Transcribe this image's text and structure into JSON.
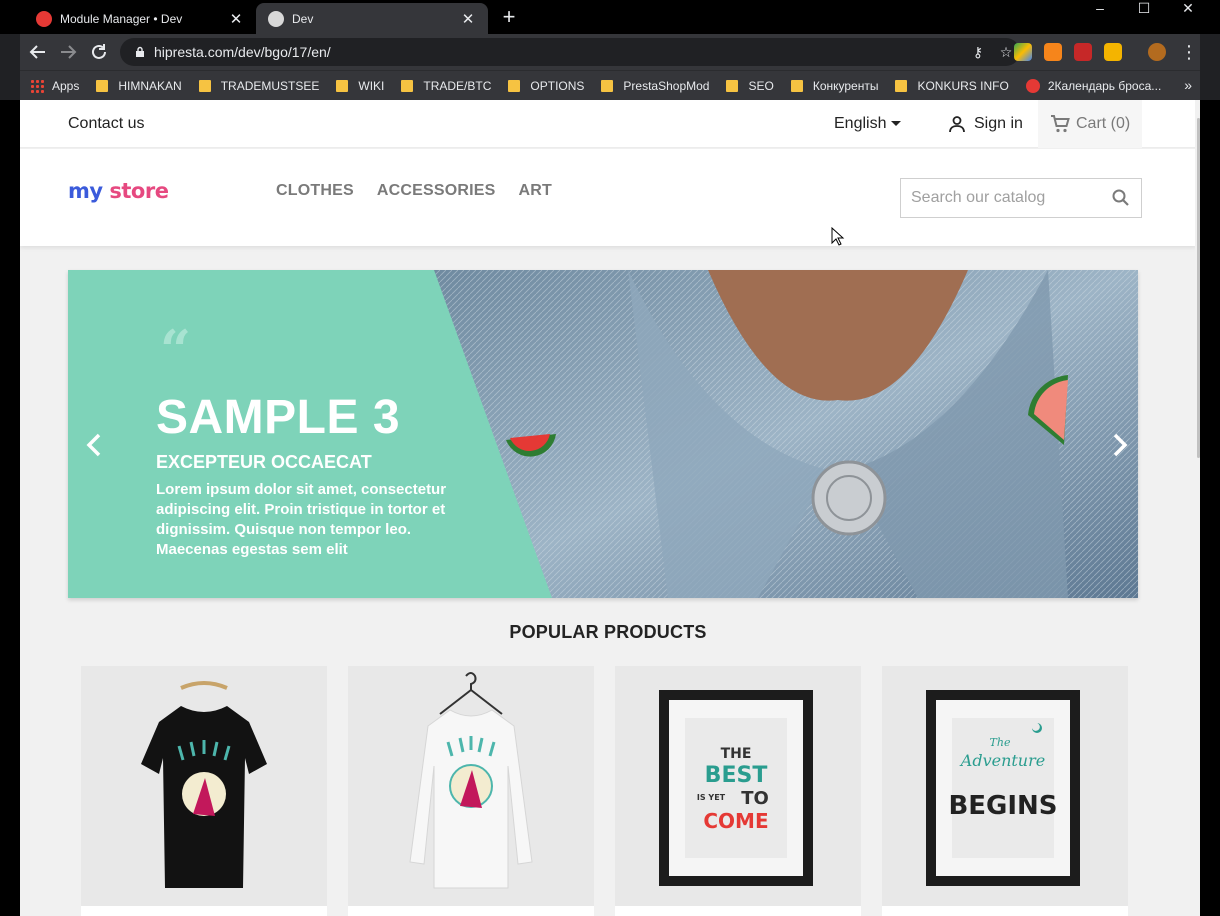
{
  "browser": {
    "tabs": [
      {
        "title": "Module Manager • Dev",
        "active": false
      },
      {
        "title": "Dev",
        "active": true
      }
    ],
    "new_tab_symbol": "+",
    "close_symbol": "✕",
    "window_controls": [
      "–",
      "☐",
      "✕"
    ],
    "url": "hipresta.com/dev/bgo/17/en/",
    "bookmarks": [
      "Apps",
      "HIMNAKAN",
      "TRADEMUSTSEE",
      "WIKI",
      "TRADE/BTC",
      "OPTIONS",
      "PrestaShopMod",
      "SEO",
      "Конкуренты",
      "KONKURS INFO",
      "2Календарь броса..."
    ],
    "more_symbol": "»"
  },
  "store": {
    "contact": "Contact us",
    "language": "English",
    "signin": "Sign in",
    "cart": "Cart (0)",
    "logo": {
      "first": "my",
      "second": "store"
    },
    "menu": [
      "CLOTHES",
      "ACCESSORIES",
      "ART"
    ],
    "search_placeholder": "Search our catalog"
  },
  "slider": {
    "quote_mark": "“",
    "title": "SAMPLE 3",
    "subtitle": "EXCEPTEUR OCCAECAT",
    "text": "Lorem ipsum dolor sit amet, consectetur adipiscing elit. Proin tristique in tortor et dignissim. Quisque non tempor leo. Maecenas egestas sem elit"
  },
  "popular": {
    "title": "POPULAR PRODUCTS",
    "products": [
      {
        "name": "black-tshirt",
        "poster_lines": []
      },
      {
        "name": "white-sweater",
        "poster_lines": []
      },
      {
        "name": "poster-the-best",
        "poster_lines": [
          "THE",
          "BEST",
          "IS YET",
          "TO",
          "COME"
        ]
      },
      {
        "name": "poster-adventure",
        "poster_lines": [
          "The",
          "Adventure",
          "BEGINS"
        ]
      }
    ]
  },
  "colors": {
    "slider_bg": "#7ed3b9",
    "page_bg": "#f1f1f1",
    "accent_red": "#e53935",
    "accent_teal": "#2a9d8f"
  }
}
